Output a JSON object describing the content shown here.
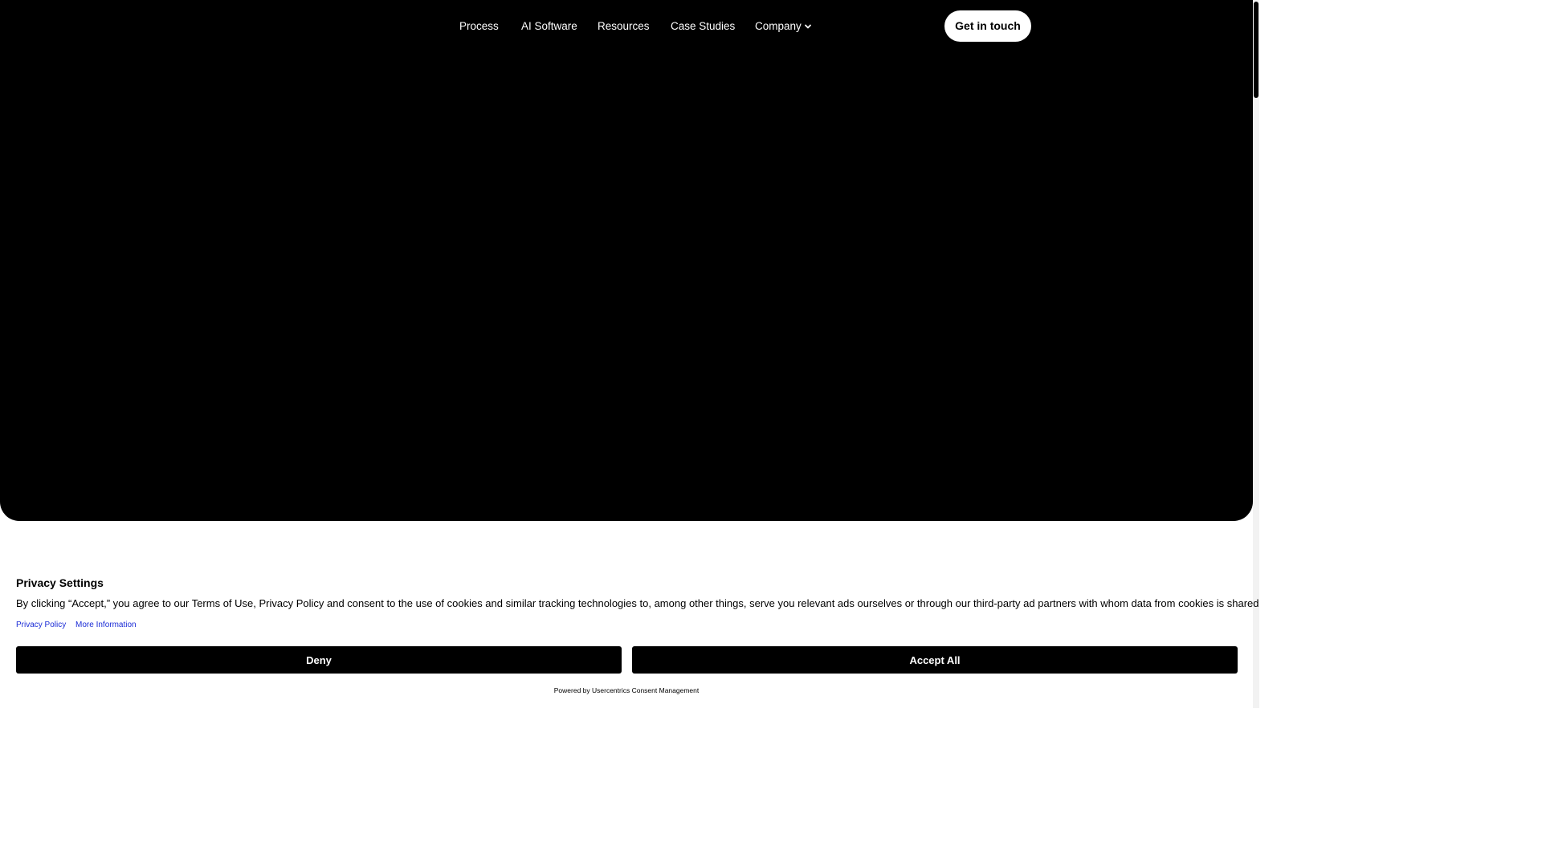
{
  "nav": {
    "items": [
      {
        "label": "Process"
      },
      {
        "label": "AI Software"
      },
      {
        "label": "Resources"
      },
      {
        "label": "Case Studies"
      },
      {
        "label": "Company",
        "has_dropdown": true,
        "icon": "chevron-down-icon"
      }
    ],
    "cta_label": "Get in touch"
  },
  "consent": {
    "title": "Privacy Settings",
    "body": "By clicking “Accept,” you agree to our Terms of Use, Privacy Policy and consent to the use of cookies and similar tracking technologies to, among other things, serve you relevant ads ourselves or through our third-party ad partners with whom data from cookies is shared.",
    "links": [
      {
        "label": "Privacy Policy"
      },
      {
        "label": "More Information"
      }
    ],
    "deny_label": "Deny",
    "accept_label": "Accept All",
    "powered_by": "Powered by Usercentrics Consent Management"
  },
  "colors": {
    "hero_background": "#000000",
    "page_background": "#ffffff",
    "link_color": "#1a2bd6",
    "button_background": "#000000"
  }
}
